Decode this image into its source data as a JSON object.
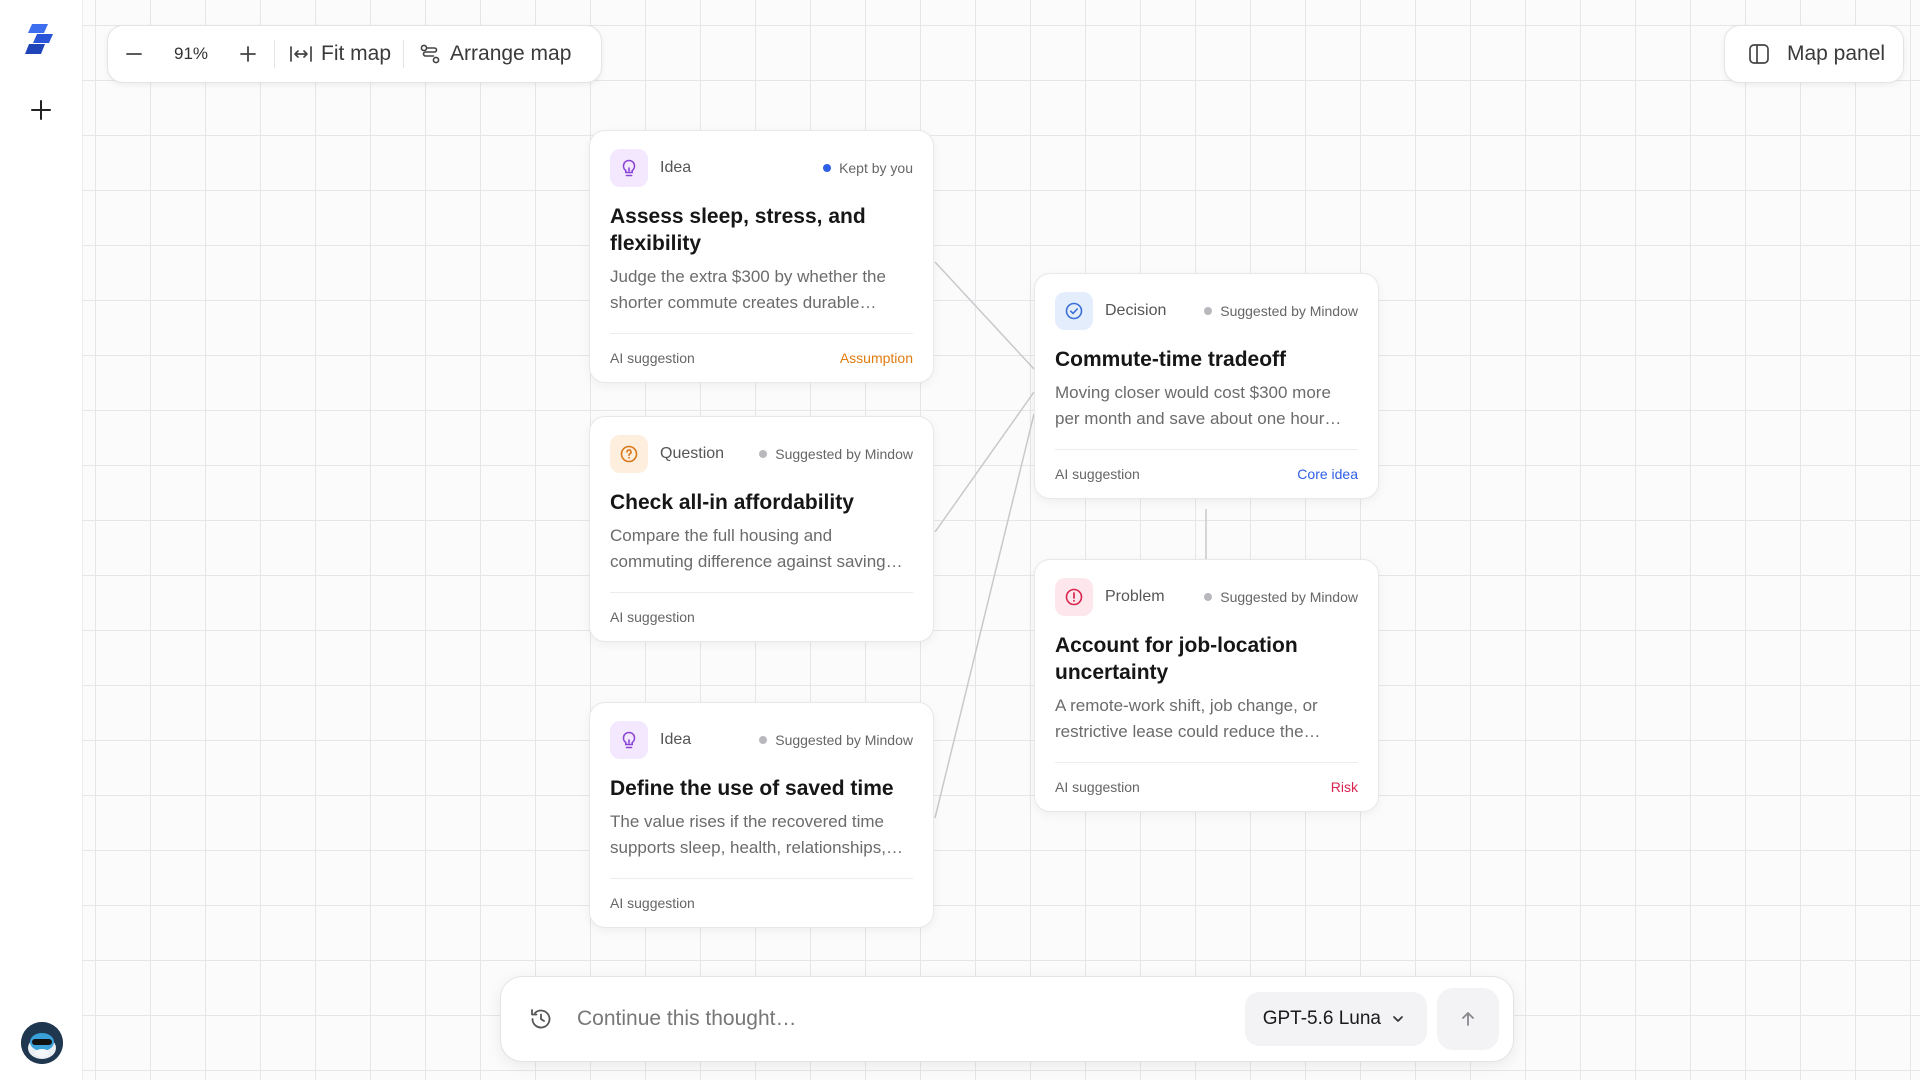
{
  "colors": {
    "accent": "#2e5fe6",
    "idea": "#8b45d6",
    "question": "#d9781a",
    "decision": "#3b6fd9",
    "problem": "#d9244f",
    "assumption": "#e07b10",
    "core_idea": "#2e5fe6",
    "risk": "#d9244f",
    "kept_dot": "#2e5fe6",
    "suggested_dot": "#b9b9bd"
  },
  "toolbar": {
    "zoom_out_icon": "minus-icon",
    "zoom_level": "91%",
    "zoom_in_icon": "plus-icon",
    "fit_map_label": "Fit map",
    "arrange_map_label": "Arrange map"
  },
  "map_panel": {
    "label": "Map panel",
    "icon": "panel-icon"
  },
  "cards": [
    {
      "type": "Idea",
      "icon": "lightbulb-icon",
      "status": "Kept by you",
      "title": "Assess sleep, stress, and flexibility",
      "description": "Judge the extra $300 by whether the shorter commute creates durable…",
      "footer": "AI suggestion",
      "tag": "Assumption"
    },
    {
      "type": "Question",
      "icon": "question-icon",
      "status": "Suggested by Mindow",
      "title": "Check all-in affordability",
      "description": "Compare the full housing and commuting difference against saving…",
      "footer": "AI suggestion",
      "tag": ""
    },
    {
      "type": "Idea",
      "icon": "lightbulb-icon",
      "status": "Suggested by Mindow",
      "title": "Define the use of saved time",
      "description": "The value rises if the recovered time supports sleep, health, relationships,…",
      "footer": "AI suggestion",
      "tag": ""
    },
    {
      "type": "Decision",
      "icon": "check-circle-icon",
      "status": "Suggested by Mindow",
      "title": "Commute-time tradeoff",
      "description": "Moving closer would cost $300 more per month and save about one hour…",
      "footer": "AI suggestion",
      "tag": "Core idea"
    },
    {
      "type": "Problem",
      "icon": "alert-icon",
      "status": "Suggested by Mindow",
      "title": "Account for job-location uncertainty",
      "description": "A remote-work shift, job change, or restrictive lease could reduce the…",
      "footer": "AI suggestion",
      "tag": "Risk"
    }
  ],
  "composer": {
    "history_icon": "history-icon",
    "placeholder": "Continue this thought…",
    "model": "GPT-5.6 Luna",
    "send_icon": "arrow-up-icon"
  }
}
